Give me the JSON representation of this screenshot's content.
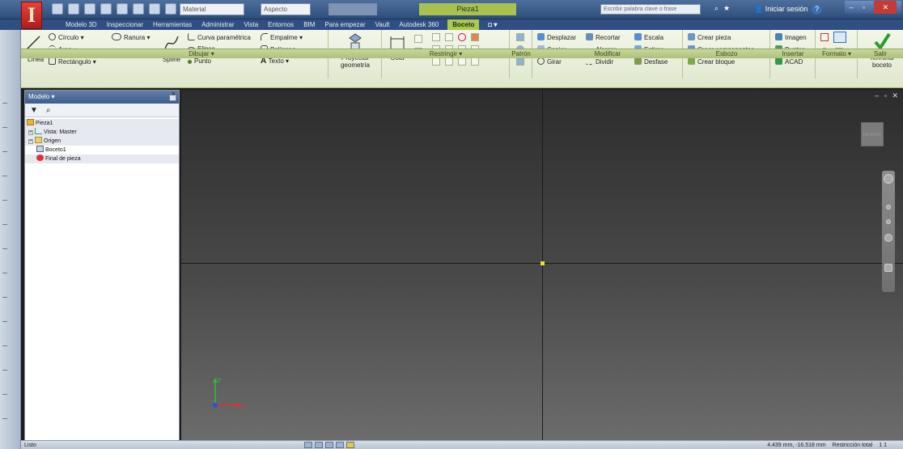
{
  "app": {
    "logo_letter": "I"
  },
  "quick_access": {
    "material": "Material",
    "appearance": "Aspecto"
  },
  "title": {
    "document": "Pieza1"
  },
  "search": {
    "placeholder": "Escribir palabra clave o frase"
  },
  "account": {
    "signin": "Iniciar sesión"
  },
  "tabs": [
    {
      "label": "Modelo 3D"
    },
    {
      "label": "Inspeccionar"
    },
    {
      "label": "Herramientas"
    },
    {
      "label": "Administrar"
    },
    {
      "label": "Vista"
    },
    {
      "label": "Entornos"
    },
    {
      "label": "BIM"
    },
    {
      "label": "Para empezar"
    },
    {
      "label": "Vault"
    },
    {
      "label": "Autodesk 360"
    },
    {
      "label": "Boceto",
      "active": true
    },
    {
      "label": "◘ ▾"
    }
  ],
  "ribbon": {
    "draw": {
      "line": "Línea",
      "circle": "Círculo ▾",
      "arc": "Arco ▾",
      "rectangle": "Rectángulo ▾",
      "slot": "Ranura ▾",
      "spline": "Spline",
      "param_curve": "Curva paramétrica",
      "fillet": "Empalme ▾",
      "ellipse": "Elipse",
      "polygon": "Polígono",
      "point": "Punto",
      "text": "Texto ▾",
      "project": "Proyectar geometría"
    },
    "dimension": {
      "label": "Cota"
    },
    "modify": {
      "move": "Desplazar",
      "trim": "Recortar",
      "scale": "Escala",
      "copy": "Copiar",
      "extend": "Alargar",
      "stretch": "Estirar",
      "rotate": "Girar",
      "split": "Dividir",
      "offset": "Desfase"
    },
    "layout": {
      "make_part": "Crear pieza",
      "make_components": "Crear componentes",
      "create_block": "Crear bloque"
    },
    "insert": {
      "image": "Imagen",
      "points": "Puntos",
      "acad": "ACAD"
    },
    "exit": {
      "finish": "Terminar boceto"
    },
    "panels": {
      "draw": "Dibujar ▾",
      "constrain": "Restringir ▾",
      "pattern": "Patrón",
      "modify": "Modificar",
      "layout": "Esbozo",
      "insert": "Insertar",
      "format": "Formato ▾",
      "exit": "Salir"
    }
  },
  "browser": {
    "header": "Modelo ▾",
    "tree": [
      {
        "label": "Pieza1",
        "indent": 0,
        "icon": "part-icon",
        "toggle": ""
      },
      {
        "label": "Vista: Master",
        "indent": 1,
        "icon": "view-icon",
        "toggle": "+"
      },
      {
        "label": "Origen",
        "indent": 1,
        "icon": "folder-icon",
        "toggle": "+"
      },
      {
        "label": "Boceto1",
        "indent": 1,
        "icon": "sketch-icon",
        "toggle": ""
      },
      {
        "label": "Final de pieza",
        "indent": 1,
        "icon": "end-of-part-icon",
        "toggle": ""
      }
    ]
  },
  "viewport": {
    "viewcube_label": "FRONTAL",
    "axis_y": "Y",
    "axis_x": "X",
    "window_controls": "– ▫ ✕"
  },
  "status": {
    "left": "Listo",
    "coords": "4.439 mm, -16.518 mm",
    "dof": "Restricción total",
    "counts": "1    1"
  },
  "colors": {
    "ribbon_active_tab": "#a9c94f",
    "title_bar": "#2e4d7b",
    "viewport_top": "#2c2c2c"
  }
}
